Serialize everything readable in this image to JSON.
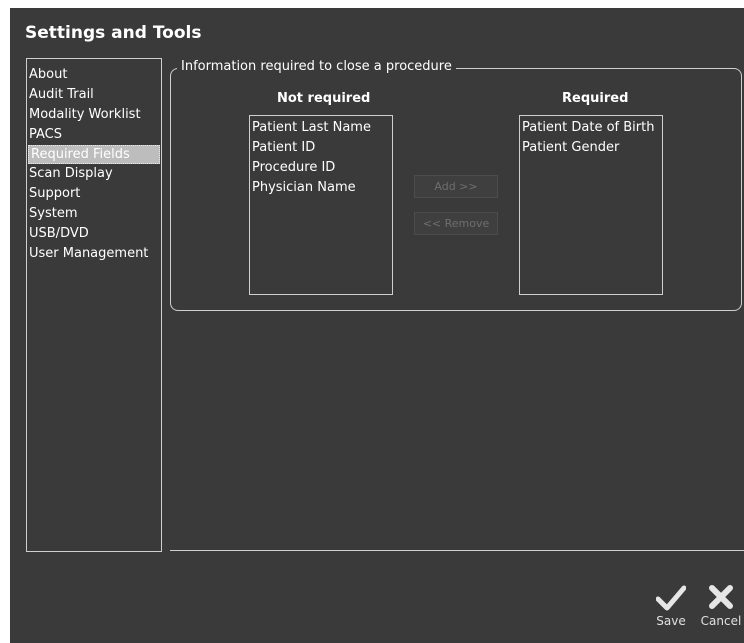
{
  "window": {
    "title": "Settings and Tools"
  },
  "sidebar": {
    "items": [
      {
        "label": "About",
        "name": "sidebar-item-about",
        "selected": false
      },
      {
        "label": "Audit Trail",
        "name": "sidebar-item-audit-trail",
        "selected": false
      },
      {
        "label": "Modality Worklist",
        "name": "sidebar-item-modality-worklist",
        "selected": false
      },
      {
        "label": "PACS",
        "name": "sidebar-item-pacs",
        "selected": false
      },
      {
        "label": "Required Fields",
        "name": "sidebar-item-required-fields",
        "selected": true
      },
      {
        "label": "Scan Display",
        "name": "sidebar-item-scan-display",
        "selected": false
      },
      {
        "label": "Support",
        "name": "sidebar-item-support",
        "selected": false
      },
      {
        "label": "System",
        "name": "sidebar-item-system",
        "selected": false
      },
      {
        "label": "USB/DVD",
        "name": "sidebar-item-usb-dvd",
        "selected": false
      },
      {
        "label": "User Management",
        "name": "sidebar-item-user-management",
        "selected": false
      }
    ]
  },
  "group": {
    "title": "Information required to close a procedure",
    "not_required": {
      "header": "Not required",
      "items": [
        "Patient Last Name",
        "Patient ID",
        "Procedure ID",
        "Physician Name"
      ]
    },
    "required": {
      "header": "Required",
      "items": [
        "Patient Date of Birth",
        "Patient Gender"
      ]
    },
    "add_label": "Add >>",
    "remove_label": "<< Remove"
  },
  "footer": {
    "save_label": "Save",
    "cancel_label": "Cancel"
  },
  "colors": {
    "background": "#3a3a3a",
    "disabled_text": "#6e6e6e",
    "selection": "#bdbdbd"
  },
  "icons": {
    "save": "checkmark-icon",
    "cancel": "close-icon"
  }
}
